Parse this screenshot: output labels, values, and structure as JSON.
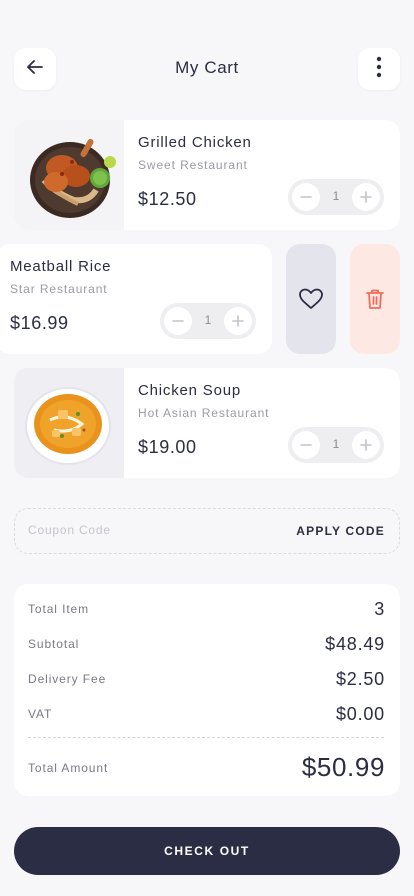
{
  "header": {
    "title": "My Cart",
    "back_icon": "arrow-left-icon",
    "more_icon": "more-vertical-icon"
  },
  "cart": {
    "items": [
      {
        "name": "Grilled Chicken",
        "restaurant": "Sweet Restaurant",
        "price": "$12.50",
        "quantity": "1",
        "image_icon": "grilled-chicken-image"
      },
      {
        "name": "Meatball Rice",
        "restaurant": "Star Restaurant",
        "price": "$16.99",
        "quantity": "1",
        "swiped": true
      },
      {
        "name": "Chicken Soup",
        "restaurant": "Hot Asian Restaurant",
        "price": "$19.00",
        "quantity": "1",
        "image_icon": "chicken-soup-image"
      }
    ],
    "swipe_actions": {
      "favorite_icon": "heart-icon",
      "delete_icon": "trash-icon"
    }
  },
  "coupon": {
    "placeholder": "Coupon Code",
    "value": "",
    "apply_label": "APPLY CODE"
  },
  "summary": {
    "total_item_label": "Total Item",
    "total_item_value": "3",
    "subtotal_label": "Subtotal",
    "subtotal_value": "$48.49",
    "delivery_label": "Delivery Fee",
    "delivery_value": "$2.50",
    "vat_label": "VAT",
    "vat_value": "$0.00",
    "total_amount_label": "Total Amount",
    "total_amount_value": "$50.99"
  },
  "checkout_label": "CHECK OUT",
  "colors": {
    "background": "#f7f7f9",
    "primary": "#2b2d45",
    "favorite_bg": "#e3e4ec",
    "delete_bg": "#fde8e4",
    "delete_icon": "#f06b5a"
  }
}
